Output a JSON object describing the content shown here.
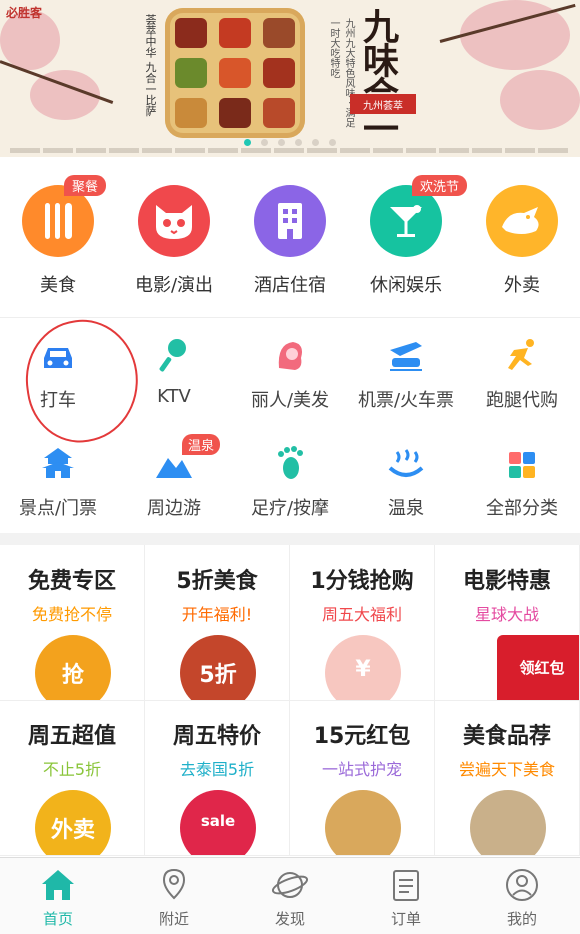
{
  "banner": {
    "brand": "必胜客",
    "left_slogan": "荟萃中华 九合一比萨",
    "title": "九味合一",
    "stamp": "九州荟萃",
    "right_slogan": "九州九大特色风味 · 满足一时大吃特吃",
    "slide_count": 6,
    "active_slide": 0
  },
  "categories": [
    {
      "label": "美食",
      "badge": "聚餐",
      "color": "#ff8a2b",
      "icon": "fork-knife-icon"
    },
    {
      "label": "电影/演出",
      "badge": "",
      "color": "#f0484c",
      "icon": "cat-icon"
    },
    {
      "label": "酒店住宿",
      "badge": "",
      "color": "#8b65e6",
      "icon": "building-icon"
    },
    {
      "label": "休闲娱乐",
      "badge": "欢洗节",
      "color": "#16c3a0",
      "icon": "cocktail-icon"
    },
    {
      "label": "外卖",
      "badge": "",
      "color": "#ffb52a",
      "icon": "delivery-icon"
    }
  ],
  "subcategories": [
    {
      "label": "打车",
      "badge": "",
      "icon": "car-icon",
      "color": "#2d7ff0"
    },
    {
      "label": "KTV",
      "badge": "",
      "icon": "microphone-icon",
      "color": "#22bfa5"
    },
    {
      "label": "丽人/美发",
      "badge": "",
      "icon": "woman-hair-icon",
      "color": "#f26a7d"
    },
    {
      "label": "机票/火车票",
      "badge": "",
      "icon": "plane-train-icon",
      "color": "#2d8ef2"
    },
    {
      "label": "跑腿代购",
      "badge": "",
      "icon": "runner-icon",
      "color": "#ffb422"
    },
    {
      "label": "景点/门票",
      "badge": "",
      "icon": "pagoda-icon",
      "color": "#2d8ef2"
    },
    {
      "label": "周边游",
      "badge": "温泉",
      "icon": "mountain-icon",
      "color": "#2d8ef2"
    },
    {
      "label": "足疗/按摩",
      "badge": "",
      "icon": "footprint-icon",
      "color": "#22bfa5"
    },
    {
      "label": "温泉",
      "badge": "",
      "icon": "hot-spring-icon",
      "color": "#2d8ef2"
    },
    {
      "label": "全部分类",
      "badge": "",
      "icon": "grid-icon",
      "color": "#ff6b6b"
    }
  ],
  "promos": [
    {
      "title": "免费专区",
      "subtitle": "免费抢不停",
      "sub_color": "#ff9a00",
      "pic_text": "抢",
      "pic_color": "#f3a21d"
    },
    {
      "title": "5折美食",
      "subtitle": "开年福利!",
      "sub_color": "#ff6a00",
      "pic_text": "5折",
      "pic_color": "#c4462b"
    },
    {
      "title": "1分钱抢购",
      "subtitle": "周五大福利",
      "sub_color": "#f0484c",
      "pic_text": "¥",
      "pic_color": "#f7c7c0"
    },
    {
      "title": "电影特惠",
      "subtitle": "星球大战",
      "sub_color": "#e44aa0",
      "pic_text": "领红包",
      "pic_color": "#d81e2c"
    },
    {
      "title": "周五超值",
      "subtitle": "不止5折",
      "sub_color": "#8ac53a",
      "pic_text": "外卖",
      "pic_color": "#f2b31b"
    },
    {
      "title": "周五特价",
      "subtitle": "去泰国5折",
      "sub_color": "#1fb0c9",
      "pic_text": "sale",
      "pic_color": "#e0264a"
    },
    {
      "title": "15元红包",
      "subtitle": "一站式护宠",
      "sub_color": "#9b6ad9",
      "pic_text": "",
      "pic_color": "#d9a85c"
    },
    {
      "title": "美食品荐",
      "subtitle": "尝遍天下美食",
      "sub_color": "#ff8a00",
      "pic_text": "",
      "pic_color": "#c9b08a"
    }
  ],
  "tabs": [
    {
      "label": "首页",
      "icon": "home-icon",
      "active": true
    },
    {
      "label": "附近",
      "icon": "location-pin-icon",
      "active": false
    },
    {
      "label": "发现",
      "icon": "planet-icon",
      "active": false
    },
    {
      "label": "订单",
      "icon": "order-list-icon",
      "active": false
    },
    {
      "label": "我的",
      "icon": "user-icon",
      "active": false
    }
  ],
  "colors": {
    "accent": "#1fb8a8",
    "annotation_circle": "#e3393a"
  }
}
